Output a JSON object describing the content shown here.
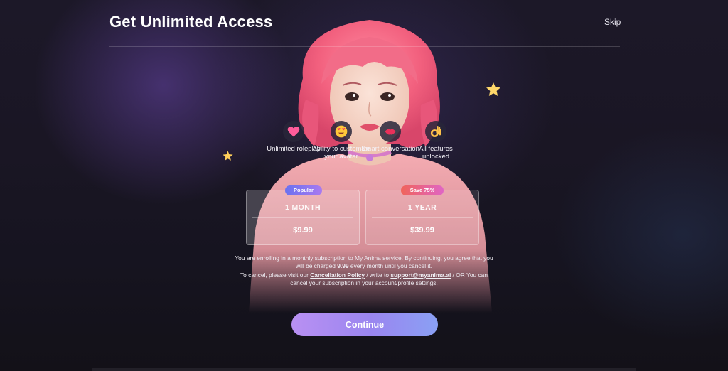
{
  "header": {
    "title": "Get Unlimited Access",
    "skip_label": "Skip"
  },
  "features": [
    {
      "icon": "heart-icon",
      "label": "Unlimited roleplay"
    },
    {
      "icon": "heart-eyes-icon",
      "label": "Ability to customize your avatar"
    },
    {
      "icon": "kiss-lips-icon",
      "label": "Smart conversation"
    },
    {
      "icon": "ok-hand-icon",
      "label": "All features unlocked"
    }
  ],
  "plans": [
    {
      "badge": "Popular",
      "period": "1 MONTH",
      "price": "$9.99",
      "selected": true
    },
    {
      "badge": "Save 75%",
      "period": "1 YEAR",
      "price": "$39.99",
      "selected": false
    }
  ],
  "legal": {
    "line1_pre": "You are enrolling in a monthly subscription to My Anima service. By continuing, you agree that you will be charged ",
    "line1_amount": "9.99",
    "line1_post": " every month until you cancel it.",
    "line2_pre": "To cancel, please visit our ",
    "cancellation_link": "Cancellation Policy",
    "line2_mid": " / write to ",
    "support_email": "support@myanima.ai",
    "line2_post": " / OR You can cancel your subscription in your account/profile settings."
  },
  "cta": {
    "continue_label": "Continue"
  },
  "colors": {
    "background": "#1a1624",
    "accent_gradient_start": "#b990f2",
    "accent_gradient_end": "#8aa0f4",
    "popular_badge": "#6a72f0",
    "save_badge": "#f0645a",
    "hair": "#f2607e"
  }
}
